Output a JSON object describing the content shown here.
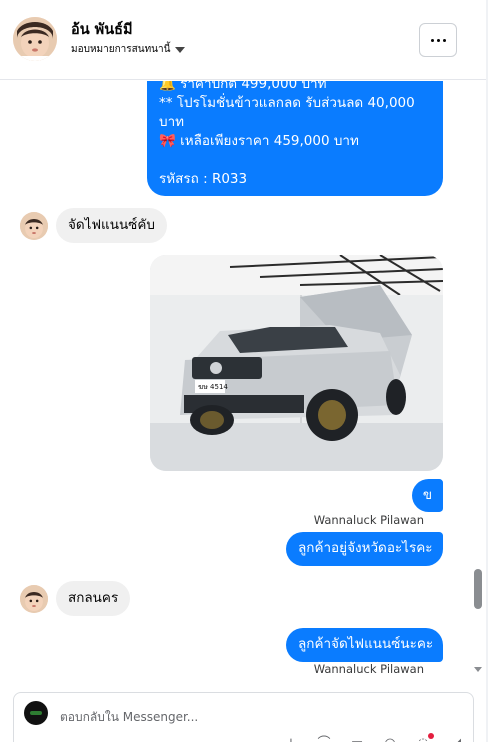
{
  "contact": {
    "name": "อ้น พันธ์มี",
    "assignment": "มอบหมายการสนทนานี้"
  },
  "messages": {
    "top_bubble": [
      "🔔 ราคาปกติ 499,000 บาท",
      "** โปรโมชั่นข้าวแลกลด รับส่วนลด 40,000",
      "บาท",
      "🎀  เหลือเพียงราคา 459,000 บาท",
      "",
      "รหัสรถ : R033"
    ],
    "in_1": "จัดไฟแนนซ์คับ",
    "out_1": "ข",
    "sender_1": "Wannaluck Pilawan",
    "out_2": "ลูกค้าอยู่จังหวัดอะไรคะ",
    "in_2": "สกลนคร",
    "out_3": "ลูกค้าจัดไฟแนนซ์นะคะ",
    "sender_2": "Wannaluck Pilawan"
  },
  "photo": {
    "plate": "ฆษ 4514"
  },
  "composer": {
    "placeholder": "ตอบกลับใน Messenger..."
  },
  "colors": {
    "outgoing": "#0a7cff",
    "incoming": "#f0f0f0"
  }
}
